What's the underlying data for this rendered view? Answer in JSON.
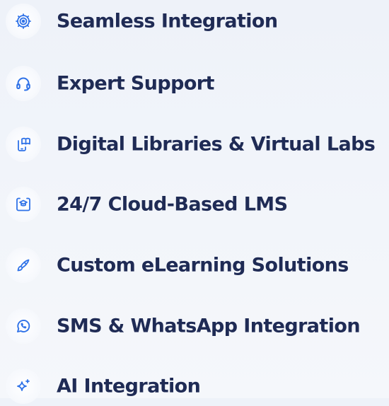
{
  "theme": {
    "icon_color": "#2f72e8",
    "text_color": "#1f2b55"
  },
  "features": [
    {
      "label": "Seamless Integration",
      "icon": "gear-target-icon"
    },
    {
      "label": "Expert Support",
      "icon": "headset-icon"
    },
    {
      "label": "Digital Libraries & Virtual Labs",
      "icon": "mobile-book-icon"
    },
    {
      "label": "24/7 Cloud-Based LMS",
      "icon": "cloud-graduation-cap-icon"
    },
    {
      "label": "Custom eLearning Solutions",
      "icon": "pen-nib-icon"
    },
    {
      "label": "SMS & WhatsApp Integration",
      "icon": "whatsapp-icon"
    },
    {
      "label": "AI Integration",
      "icon": "sparkle-icon"
    }
  ]
}
